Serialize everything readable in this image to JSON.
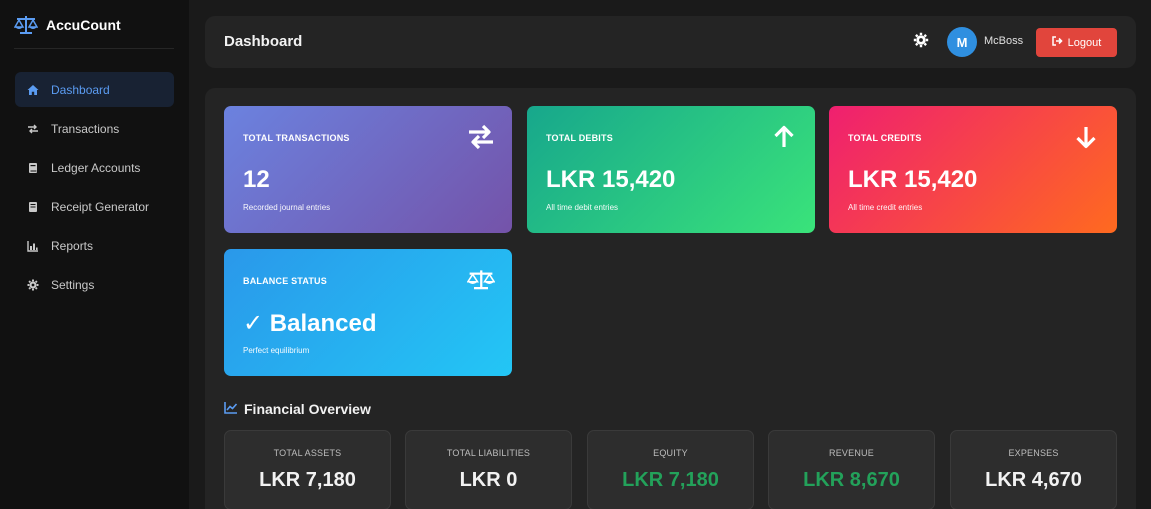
{
  "colors": {
    "sidebar_bg": "#111111",
    "page_bg": "#1a1a1a",
    "panel_bg": "#242424",
    "accent_blue": "#5b9cf2",
    "logout_red": "#e1453c",
    "positive_green": "#23a15a"
  },
  "brand": {
    "title": "AccuCount",
    "icon": "balance-scale-icon"
  },
  "sidebar": {
    "items": [
      {
        "label": "Dashboard",
        "icon": "home-icon",
        "active": true
      },
      {
        "label": "Transactions",
        "icon": "exchange-icon",
        "active": false
      },
      {
        "label": "Ledger Accounts",
        "icon": "book-icon",
        "active": false
      },
      {
        "label": "Receipt Generator",
        "icon": "receipt-icon",
        "active": false
      },
      {
        "label": "Reports",
        "icon": "bar-chart-icon",
        "active": false
      },
      {
        "label": "Settings",
        "icon": "gear-icon",
        "active": false
      }
    ]
  },
  "header": {
    "title": "Dashboard",
    "settings_icon": "gear-icon",
    "avatar_initial": "M",
    "user_name": "McBoss",
    "logout_label": "Logout",
    "logout_icon": "sign-out-icon"
  },
  "cards": {
    "transactions": {
      "label": "TOTAL TRANSACTIONS",
      "value": "12",
      "sub": "Recorded journal entries",
      "icon": "exchange-icon"
    },
    "debits": {
      "label": "TOTAL DEBITS",
      "value": "LKR 15,420",
      "sub": "All time debit entries",
      "icon": "arrow-up-icon"
    },
    "credits": {
      "label": "TOTAL CREDITS",
      "value": "LKR 15,420",
      "sub": "All time credit entries",
      "icon": "arrow-down-icon"
    },
    "balance": {
      "label": "BALANCE STATUS",
      "value": "✓ Balanced",
      "sub": "Perfect equilibrium",
      "icon": "balance-scale-icon"
    }
  },
  "overview": {
    "title": "Financial Overview",
    "icon": "line-chart-icon",
    "stats": [
      {
        "label": "TOTAL ASSETS",
        "value": "LKR 7,180"
      },
      {
        "label": "TOTAL LIABILITIES",
        "value": "LKR 0"
      },
      {
        "label": "EQUITY",
        "value": "LKR 7,180"
      },
      {
        "label": "REVENUE",
        "value": "LKR 8,670"
      },
      {
        "label": "EXPENSES",
        "value": "LKR 4,670"
      }
    ]
  }
}
